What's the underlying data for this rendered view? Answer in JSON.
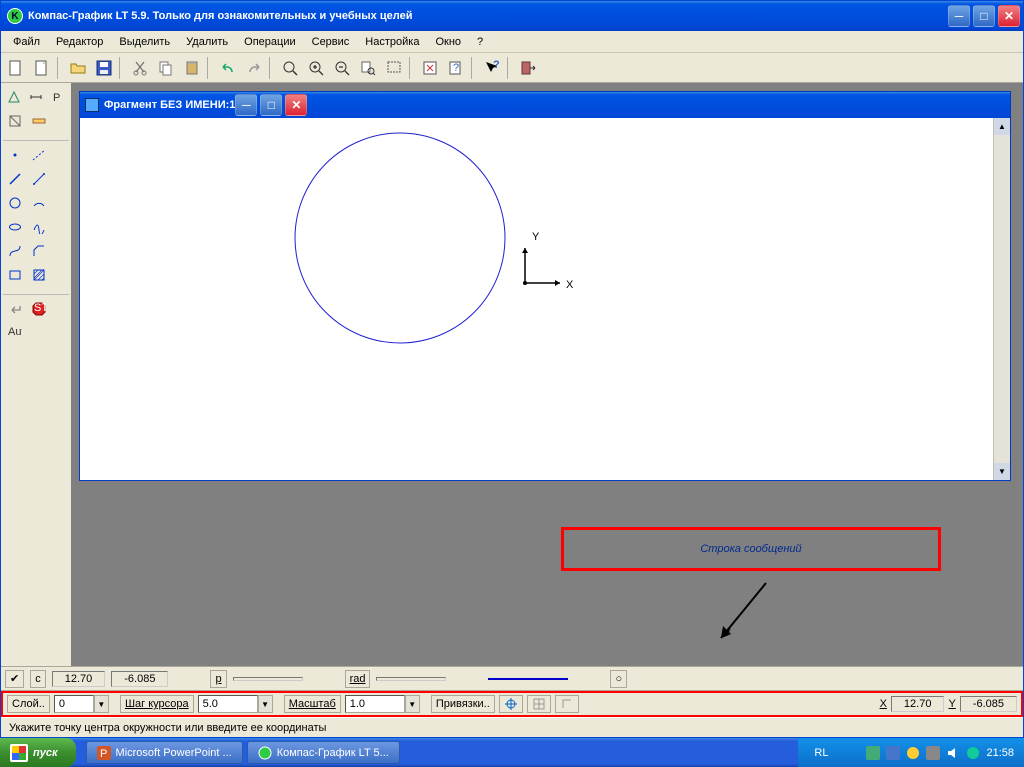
{
  "app_title": "Компас-График LT 5.9. Только для ознакомительных и учебных целей",
  "menu": [
    "Файл",
    "Редактор",
    "Выделить",
    "Удалить",
    "Операции",
    "Сервис",
    "Настройка",
    "Окно",
    "?"
  ],
  "doc_title": "Фрагмент БЕЗ ИМЕНИ:1",
  "coord_axes": {
    "x": "X",
    "y": "Y"
  },
  "callout": "Строка сообщений",
  "row1": {
    "v": "12.70",
    "h": "-6.085",
    "p": "p",
    "rad": "rad",
    "sym": "○"
  },
  "row2": {
    "layer": "Слой..",
    "layer_val": "0",
    "step": "Шаг курсора",
    "step_val": "5.0",
    "scale": "Масштаб",
    "scale_val": "1.0",
    "snap": "Привязки..",
    "x_lbl": "X",
    "x_val": "12.70",
    "y_lbl": "Y",
    "y_val": "-6.085"
  },
  "status": "Укажите точку центра окружности или введите ее координаты",
  "taskbar": {
    "start": "пуск",
    "task1": "Microsoft PowerPoint ...",
    "task2": "Компас-График LT 5...",
    "lang": "RL",
    "time": "21:58"
  }
}
